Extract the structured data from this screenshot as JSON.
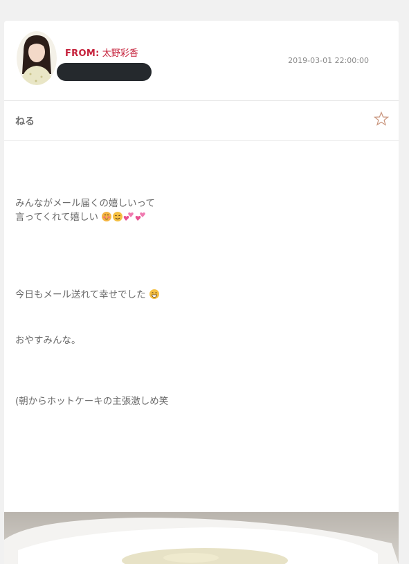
{
  "header": {
    "from_label": "FROM:",
    "sender_name": "太野彩香",
    "timestamp": "2019-03-01 22:00:00"
  },
  "subject": "ねる",
  "icons": {
    "favorite": "star-outline-icon",
    "avatar": "sender-avatar",
    "emoji_line2": [
      "blushing-face-icon",
      "smiling-face-icon",
      "two-hearts-icon",
      "two-hearts-icon"
    ],
    "emoji_line3": "grinning-face-icon"
  },
  "message": {
    "line1": "みんながメール届くの嬉しいって",
    "line2": "言ってくれて嬉しい",
    "line3": "今日もメール送れて幸せでした",
    "line4": "おやすみんな。",
    "line5": "(朝からホットケーキの主張激しめ笑"
  },
  "colors": {
    "accent": "#c5203a",
    "background": "#f1f1f1",
    "card": "#ffffff",
    "text": "#6a6a6a"
  }
}
